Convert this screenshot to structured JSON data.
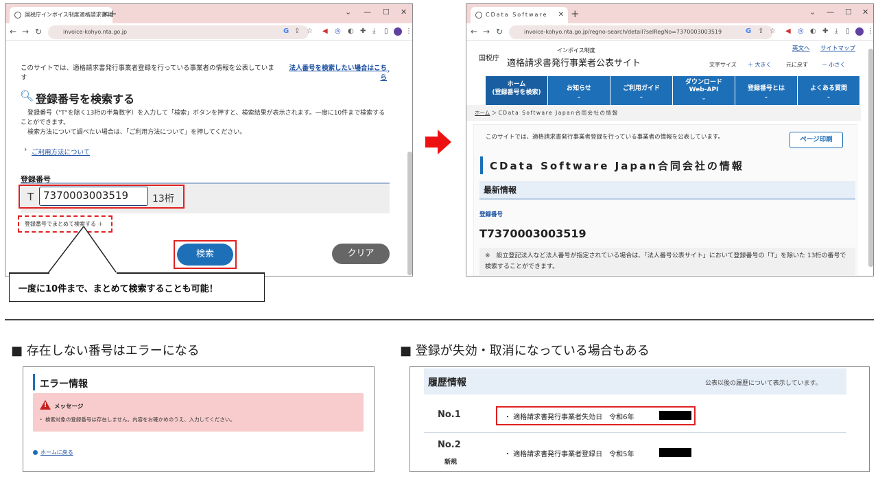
{
  "left_window": {
    "tab_title": "国税庁インボイス制度適格請求書発",
    "url": "invoice-kohyo.nta.go.jp",
    "intro": "このサイトでは、適格請求書発行事業者登録を行っている事業者の情報を公表しています",
    "corp_link": "法人番号を検索したい場合はこちら",
    "heading": "登録番号を検索する",
    "desc1": "登録番号（\"T\"を除く13桁の半角数字）を入力して「検索」ボタンを押すと、検索結果が表示されます。一度に10件まで検索することができます。",
    "desc2": "検索方法について調べたい場合は、「ご利用方法について」を押してください。",
    "usage_link": "ご利用方法について",
    "field_label": "登録番号",
    "prefix": "T",
    "number_value": "7370003003519",
    "digits": "13桁",
    "bulk_search": "登録番号でまとめて検索する ＋",
    "search_button": "検索",
    "clear_button": "クリア",
    "callout": "一度に10件まで、まとめて検索することも可能！"
  },
  "right_window": {
    "tab_title": "CData Software",
    "url": "invoice-kohyo.nta.go.jp/regno-search/detail?selRegNo=7370003003519",
    "agency": "国税庁",
    "site_small": "インボイス制度",
    "site_title": "適格請求書発行事業者公表サイト",
    "link_english": "英文へ",
    "link_sitemap": "サイトマップ",
    "font_size_label": "文字サイズ",
    "font_large": "＋ 大きく",
    "font_reset": "元に戻す",
    "font_small": "－ 小さく",
    "menu": [
      {
        "label": "ホーム\n(登録番号を検索)"
      },
      {
        "label": "お知らせ"
      },
      {
        "label": "ご利用ガイド"
      },
      {
        "label": "ダウンロード\nWeb-API"
      },
      {
        "label": "登録番号とは"
      },
      {
        "label": "よくある質問"
      }
    ],
    "breadcrumb_home": "ホーム",
    "breadcrumb_current": "CData Software Japan合同会社の情報",
    "intro": "このサイトでは、適格請求書発行事業者登録を行っている事業者の情報を公表しています。",
    "print_button": "ページ印刷",
    "company_heading": "CData Software Japan合同会社の情報",
    "latest_info": "最新情報",
    "reg_label": "登録番号",
    "reg_number": "T7370003003519",
    "note": "※　設立登記法人など法人番号が指定されている場合は、「法人番号公表サイト」において登録番号の「T」を除いた 13桁の番号で検索することができます。"
  },
  "section_error": {
    "title": "■ 存在しない番号はエラーになる",
    "panel_heading": "エラー情報",
    "message_label": "メッセージ",
    "message_text": "・ 検索対象の登録番号は存在しません。内容をお確かめのうえ、入力してください。",
    "home_link": "ホームに戻る"
  },
  "section_history": {
    "title": "■ 登録が失効・取消になっている場合もある",
    "panel_heading": "履歴情報",
    "panel_note": "公表以後の履歴について表示しています。",
    "rows": [
      {
        "no": "No.1",
        "sub": "",
        "text": "・ 適格請求書発行事業者失効日　令和6年"
      },
      {
        "no": "No.2",
        "sub": "新規",
        "text": "・ 適格請求書発行事業者登録日　令和5年"
      }
    ]
  },
  "colors": {
    "accent_red": "#e02020",
    "nav_blue": "#1d6fb8",
    "tab_pink": "#f3d6d6"
  }
}
